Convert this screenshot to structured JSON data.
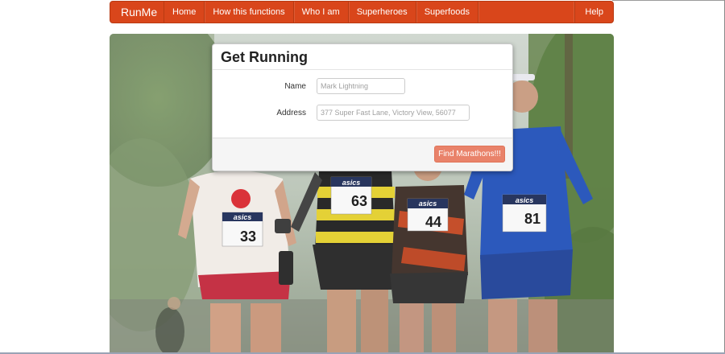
{
  "navbar": {
    "brand": "RunMe",
    "items": [
      {
        "label": "Home"
      },
      {
        "label": "How this functions"
      },
      {
        "label": "Who I am"
      },
      {
        "label": "Superheroes"
      },
      {
        "label": "Superfoods"
      }
    ],
    "help": "Help"
  },
  "form": {
    "title": "Get Running",
    "name_label": "Name",
    "name_placeholder": "Mark Lightning",
    "address_label": "Address",
    "address_placeholder": "377 Super Fast Lane, Victory View, 56077",
    "submit_label": "Find Marathons!!!"
  },
  "hero": {
    "bibs": [
      {
        "brand": "asics",
        "number": "33"
      },
      {
        "brand": "asics",
        "number": "63"
      },
      {
        "brand": "asics",
        "number": "44"
      },
      {
        "brand": "asics",
        "number": "81"
      }
    ]
  },
  "colors": {
    "navbar": "#d9461b",
    "button": "#e9826a"
  }
}
